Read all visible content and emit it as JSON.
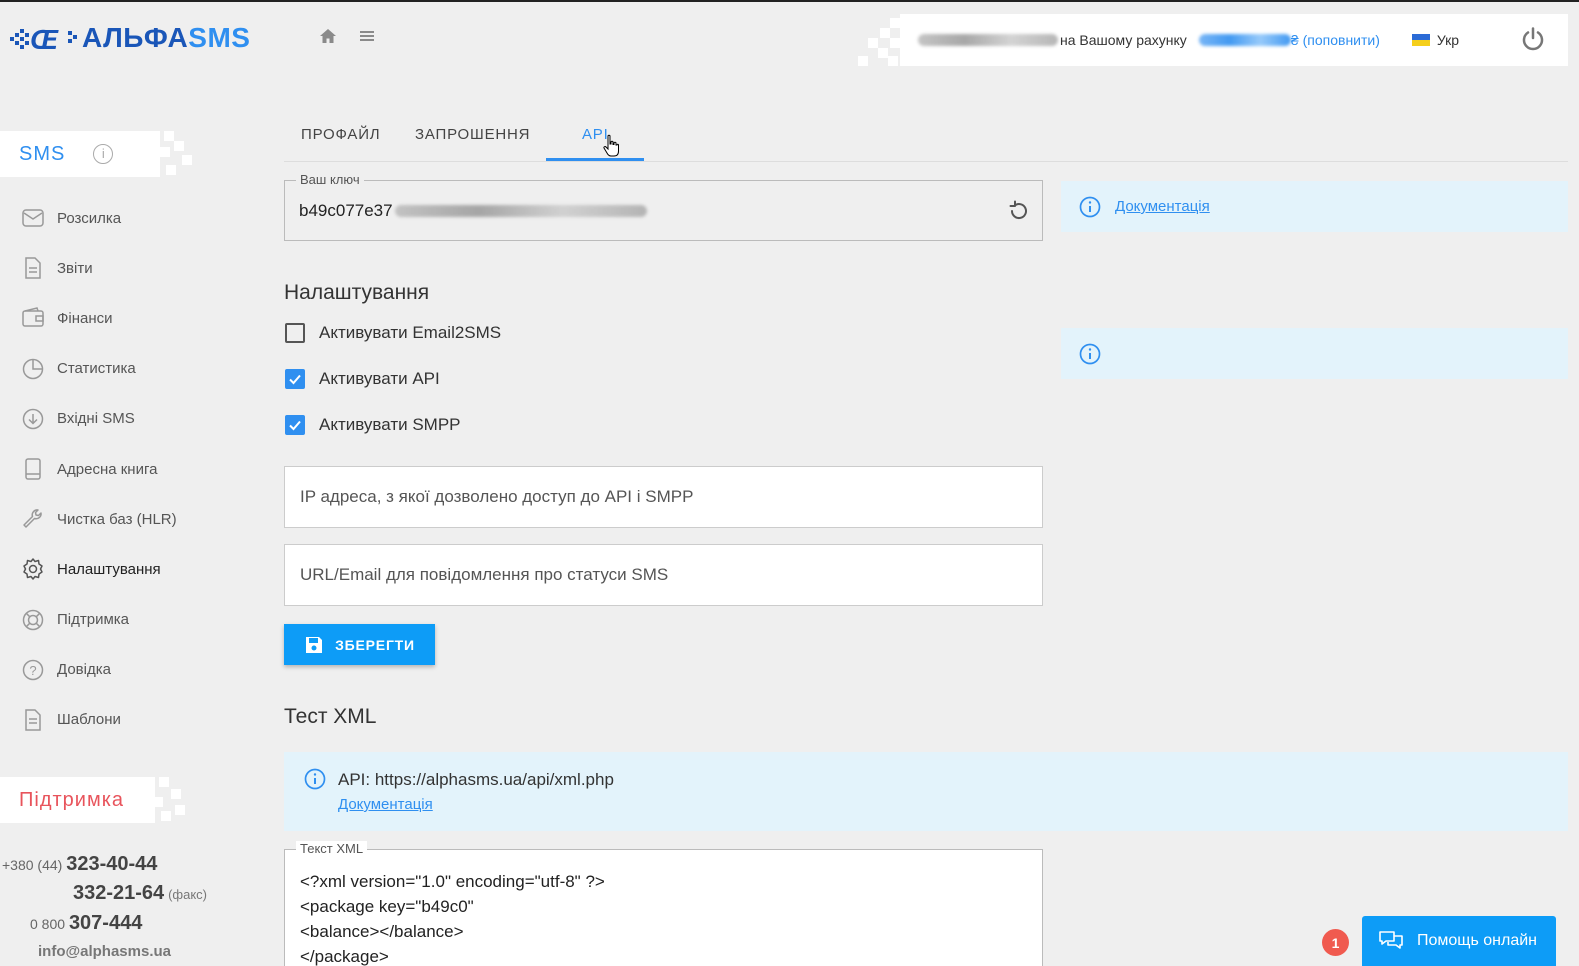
{
  "header": {
    "logo_prefix": "АЛЬФА",
    "logo_suffix": "SMS",
    "balance_label": "на Вашому рахунку",
    "currency": "₴",
    "topup_link": "(поповнити)",
    "language": "Укр",
    "icons": [
      "home-icon",
      "menu-icon",
      "power-icon"
    ]
  },
  "sidebar": {
    "section_title": "SMS",
    "items": [
      {
        "label": "Розсилка",
        "icon": "envelope-icon"
      },
      {
        "label": "Звіти",
        "icon": "document-icon"
      },
      {
        "label": "Фінанси",
        "icon": "wallet-icon"
      },
      {
        "label": "Статистика",
        "icon": "pie-chart-icon"
      },
      {
        "label": "Вхідні SMS",
        "icon": "download-icon"
      },
      {
        "label": "Адресна книга",
        "icon": "book-icon"
      },
      {
        "label": "Чистка баз (HLR)",
        "icon": "wrench-icon"
      },
      {
        "label": "Налаштування",
        "icon": "gear-icon"
      },
      {
        "label": "Підтримка",
        "icon": "lifebuoy-icon"
      },
      {
        "label": "Довідка",
        "icon": "question-icon"
      },
      {
        "label": "Шаблони",
        "icon": "template-icon"
      }
    ],
    "active_item": "Налаштування",
    "support_title": "Підтримка",
    "contacts": {
      "code1": "+380 (44)",
      "phone1": "323-40-44",
      "phone2": "332-21-64",
      "fax_label": "(факс)",
      "code2": "0 800",
      "phone3": "307-444",
      "email": "info@alphasms.ua"
    }
  },
  "tabs": [
    {
      "label": "ПРОФАЙЛ",
      "active": false
    },
    {
      "label": "ЗАПРОШЕННЯ",
      "active": false
    },
    {
      "label": "API",
      "active": true
    }
  ],
  "api_key": {
    "legend": "Ваш ключ",
    "visible_value": "b49c077e37"
  },
  "docs_panel": {
    "link": "Документація"
  },
  "settings": {
    "title": "Налаштування",
    "checkboxes": [
      {
        "label": "Активувати Email2SMS",
        "checked": false
      },
      {
        "label": "Активувати API",
        "checked": true
      },
      {
        "label": "Активувати SMPP",
        "checked": true
      }
    ],
    "ip_placeholder": "IP адреса, з якої дозволено доступ до API і SMPP",
    "url_placeholder": "URL/Email для повідомлення про статуси SMS",
    "save_label": "ЗБЕРЕГТИ"
  },
  "xml_test": {
    "title": "Тест XML",
    "api_label": "API: https://alphasms.ua/api/xml.php",
    "doc_link": "Документація",
    "legend": "Текст XML",
    "lines": [
      "<?xml version=\"1.0\" encoding=\"utf-8\" ?>",
      "<package key=\"b49c0\"",
      "<balance></balance>",
      "</package>"
    ]
  },
  "chat": {
    "label": "Помощь онлайн",
    "badge": "1"
  },
  "colors": {
    "accent": "#2f8ff0",
    "button": "#0d9cf7",
    "brand": "#1a56b8",
    "support_red": "#e8545c",
    "info_bg": "#e3f3fb"
  }
}
